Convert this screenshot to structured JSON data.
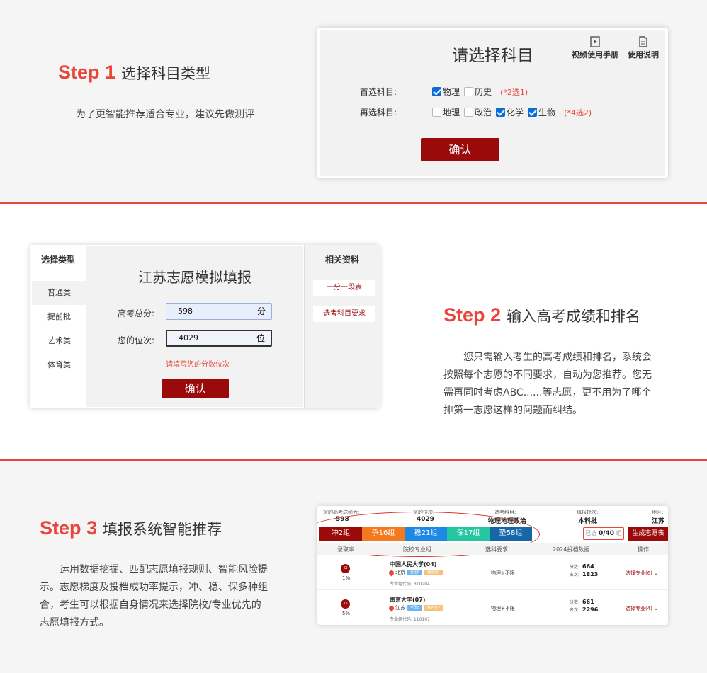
{
  "step1": {
    "num": "Step 1",
    "title": "选择科目类型",
    "desc": "为了更智能推荐适合专业，建议先做测评",
    "card": {
      "title": "请选择科目",
      "video_label": "视频使用手册",
      "doc_label": "使用说明",
      "row1_label": "首选科目:",
      "row1_options": [
        "物理",
        "历史"
      ],
      "row1_hint": "(*2选1)",
      "row2_label": "再选科目:",
      "row2_options": [
        "地理",
        "政治",
        "化学",
        "生物"
      ],
      "row2_hint": "(*4选2)",
      "confirm": "确认"
    }
  },
  "step2": {
    "num": "Step 2",
    "title": "输入高考成绩和排名",
    "desc": "您只需输入考生的高考成绩和排名，系统会按照每个志愿的不同要求，自动为您推荐。您无需再同时考虑ABC......等志愿，更不用为了哪个排第一志愿这样的问题而纠结。",
    "card": {
      "side_title": "选择类型",
      "side_items": [
        "普通类",
        "提前批",
        "艺术类",
        "体育类"
      ],
      "title": "江苏志愿模拟填报",
      "score_label": "高考总分:",
      "score_value": "598",
      "score_unit": "分",
      "rank_label": "您的位次:",
      "rank_value": "4029",
      "rank_unit": "位",
      "warning": "请填写您的分数位次",
      "confirm": "确认",
      "right_title": "相关资料",
      "right_links": [
        "一分一段表",
        "选考科目要求"
      ]
    }
  },
  "step3": {
    "num": "Step 3",
    "title": "填报系统智能推荐",
    "desc": "运用数据挖掘、匹配志愿填报规则、智能风险提示。志愿梯度及投档成功率提示，冲、稳、保多种组合，考生可以根据自身情况来选择院校/专业优先的志愿填报方式。",
    "card": {
      "top_labels": [
        "您的高考成绩为:",
        "您的位次:",
        "选考科目:",
        "填报批次:",
        "地区:"
      ],
      "top_values": [
        "598",
        "4029",
        "物理地理政治",
        "本科批",
        "江苏"
      ],
      "tabs": [
        {
          "label": "冲2组",
          "color": "#9b0a0a"
        },
        {
          "label": "争16组",
          "color": "#f47a1f"
        },
        {
          "label": "稳21组",
          "color": "#1e88e5"
        },
        {
          "label": "保17组",
          "color": "#26c6a0"
        },
        {
          "label": "垫58组",
          "color": "#1767a8"
        }
      ],
      "counter_prefix": "已选",
      "counter_value": "0/40",
      "counter_suffix": "组",
      "generate": "生成志愿表",
      "headers": [
        "录取率",
        "院校专业组",
        "选科要求",
        "2024投档数据",
        "操作"
      ],
      "rows": [
        {
          "badge": "冲",
          "pct": "1%",
          "uni": "中国人民大学(04)",
          "city": "北京",
          "tag1": "全国6",
          "tag2": "综合类1",
          "code": "专业组代码: 310204",
          "req": "物理+不限",
          "score_label": "分数:",
          "score": "664",
          "rank_label": "名次:",
          "rank": "1823",
          "op": "选择专业(6)"
        },
        {
          "badge": "冲",
          "pct": "5%",
          "uni": "南京大学(07)",
          "city": "江苏",
          "tag1": "全国8",
          "tag2": "综合类7",
          "code": "专业组代码: 110107",
          "req": "物理+不限",
          "score_label": "分数:",
          "score": "661",
          "rank_label": "名次:",
          "rank": "2296",
          "op": "选择专业(4)"
        }
      ]
    }
  }
}
